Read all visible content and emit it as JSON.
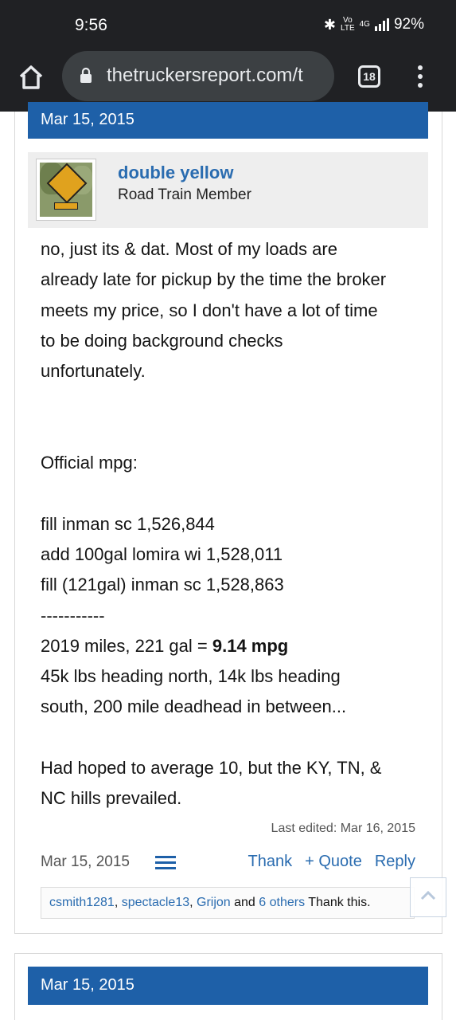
{
  "status_bar": {
    "time": "9:56",
    "volte_top": "Vo",
    "volte_bottom": "LTE",
    "network": "4G",
    "battery": "92%"
  },
  "browser": {
    "url": "thetruckersreport.com/t",
    "tab_count": "18"
  },
  "post": {
    "header_date": "Mar 15, 2015",
    "username": "double yellow",
    "user_title": "Road Train Member",
    "message_lines": [
      "no, just its & dat. Most of my loads are",
      "already late for pickup by the time the broker",
      "meets my price, so I don't have a lot of time",
      "to be doing background checks",
      "unfortunately.",
      "",
      "",
      "Official mpg:",
      "",
      "fill inman sc 1,526,844",
      "add 100gal lomira wi 1,528,011",
      "fill (121gal) inman sc 1,528,863",
      "-----------",
      "2019 miles, 221 gal = ",
      "45k lbs heading north, 14k lbs heading",
      "south, 200 mile deadhead in between...",
      "",
      "Had hoped to average 10, but the KY, TN, &",
      "NC hills prevailed."
    ],
    "mpg_bold": "9.14 mpg",
    "last_edited": "Last edited: Mar 16, 2015",
    "footer_date": "Mar 15, 2015",
    "actions": {
      "thank": "Thank",
      "quote": "+ Quote",
      "reply": "Reply"
    },
    "likes": {
      "user1": "csmith1281",
      "sep1": ", ",
      "user2": "spectacle13",
      "sep2": ", ",
      "user3": "Grijon",
      "and_text": " and ",
      "others": "6 others",
      "suffix": " Thank this."
    }
  },
  "next_post": {
    "header_date": "Mar 15, 2015"
  },
  "colors": {
    "accent": "#1e60a8",
    "link": "#2a6cb0",
    "chrome_bg": "#202124"
  }
}
